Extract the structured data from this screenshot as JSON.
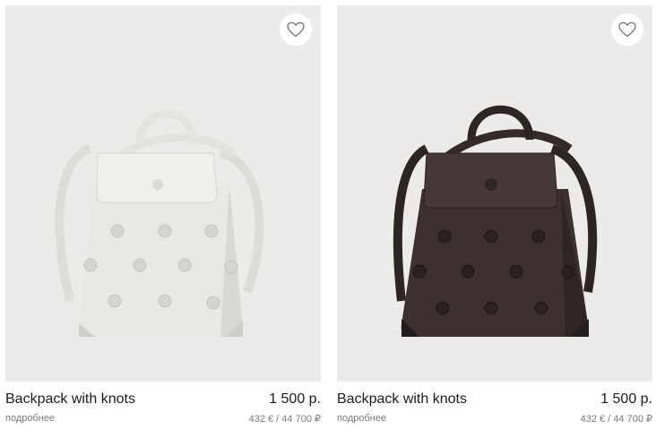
{
  "products": [
    {
      "name": "Backpack with knots",
      "price": "1 500 р.",
      "details_link": "подробнее",
      "alt_price": "432 € / 44 700 ₽",
      "bag_color": "#e9e8e3",
      "bag_shade": "#d3d2cc",
      "icon": "heart-outline-icon"
    },
    {
      "name": "Backpack with knots",
      "price": "1 500 р.",
      "details_link": "подробнее",
      "alt_price": "432 € / 44 700 ₽",
      "bag_color": "#3d3030",
      "bag_shade": "#2a2121",
      "icon": "heart-outline-icon"
    }
  ]
}
